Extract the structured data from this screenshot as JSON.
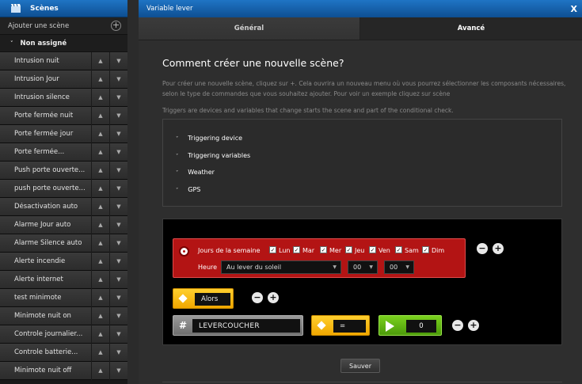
{
  "sidebar": {
    "title": "Scènes",
    "add_label": "Ajouter une scène",
    "group_label": "Non assigné",
    "items": [
      {
        "label": "Intrusion nuit"
      },
      {
        "label": "Intrusion Jour"
      },
      {
        "label": "Intrusion silence"
      },
      {
        "label": "Porte fermée nuit"
      },
      {
        "label": "Porte fermée jour"
      },
      {
        "label": "Porte fermée..."
      },
      {
        "label": "Push porte ouverte..."
      },
      {
        "label": "push porte ouverte..."
      },
      {
        "label": "Désactivation auto"
      },
      {
        "label": "Alarme Jour auto"
      },
      {
        "label": "Alarme Silence auto"
      },
      {
        "label": "Alerte incendie"
      },
      {
        "label": "Alerte internet"
      },
      {
        "label": "test minimote"
      },
      {
        "label": "Minimote nuit on"
      },
      {
        "label": "Controle journalier..."
      },
      {
        "label": "Controle batterie..."
      },
      {
        "label": "Minimote nuit off"
      }
    ]
  },
  "window": {
    "title": "Variable lever",
    "close": "X"
  },
  "tabs": [
    {
      "label": "Général"
    },
    {
      "label": "Avancé"
    }
  ],
  "content": {
    "heading": "Comment créer une nouvelle scène?",
    "paragraph1": "Pour créer une nouvelle scène, cliquez sur +. Cela ouvrira un nouveau menu où vous pourrez sélectionner les composants nécessaires, selon le type de commandes que vous souhaitez ajouter. Pour voir un exemple cliquez sur scène",
    "paragraph2": "Triggers are devices and variables that change starts the scene and part of the conditional check.",
    "triggers": [
      {
        "label": "Triggering device"
      },
      {
        "label": "Triggering variables"
      },
      {
        "label": "Weather"
      },
      {
        "label": "GPS"
      }
    ]
  },
  "condition": {
    "days_label": "Jours de la semaine",
    "days": [
      {
        "label": "Lun",
        "checked": true
      },
      {
        "label": "Mar",
        "checked": true
      },
      {
        "label": "Mer",
        "checked": true
      },
      {
        "label": "Jeu",
        "checked": true
      },
      {
        "label": "Ven",
        "checked": true
      },
      {
        "label": "Sam",
        "checked": true
      },
      {
        "label": "Dim",
        "checked": true
      }
    ],
    "time_label": "Heure",
    "time_option": "Au lever du soleil",
    "hour": "00",
    "minute": "00"
  },
  "then_label": "Alors",
  "action": {
    "variable": "LEVERCOUCHER",
    "operator": "=",
    "value": "0"
  },
  "save_label": "Sauver",
  "icons": {
    "check": "✓",
    "chevron": "˅",
    "up": "▲",
    "down": "▼",
    "minus": "−",
    "plus": "+"
  },
  "colors": {
    "header_blue": "#1565b0",
    "condition_red": "#b31414",
    "then_yellow": "#f7b912",
    "action_green": "#5cb312"
  }
}
